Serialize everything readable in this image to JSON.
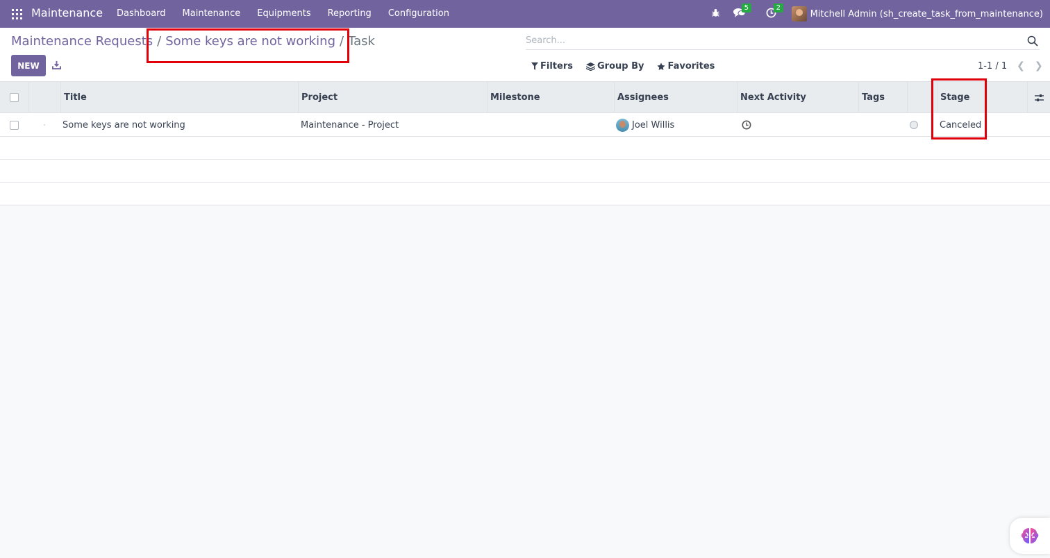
{
  "navbar": {
    "brand": "Maintenance",
    "menu": [
      "Dashboard",
      "Maintenance",
      "Equipments",
      "Reporting",
      "Configuration"
    ],
    "messages_count": "5",
    "activities_count": "2",
    "user_name": "Mitchell Admin (sh_create_task_from_maintenance)"
  },
  "breadcrumb": {
    "root": "Maintenance Requests",
    "sep": "/",
    "middle": "Some keys are not working",
    "last": "Task"
  },
  "toolbar": {
    "new_label": "NEW",
    "search_placeholder": "Search...",
    "filters_label": "Filters",
    "groupby_label": "Group By",
    "favorites_label": "Favorites",
    "pager": "1-1 / 1"
  },
  "table": {
    "columns": [
      "Title",
      "Project",
      "Milestone",
      "Assignees",
      "Next Activity",
      "Tags",
      "Stage"
    ],
    "rows": [
      {
        "title": "Some keys are not working",
        "project": "Maintenance - Project",
        "milestone": "",
        "assignee": "Joel Willis",
        "tags": "",
        "stage": "Canceled"
      }
    ]
  },
  "colors": {
    "brand": "#71639e",
    "highlight": "#e1000a",
    "badge": "#28a745"
  }
}
